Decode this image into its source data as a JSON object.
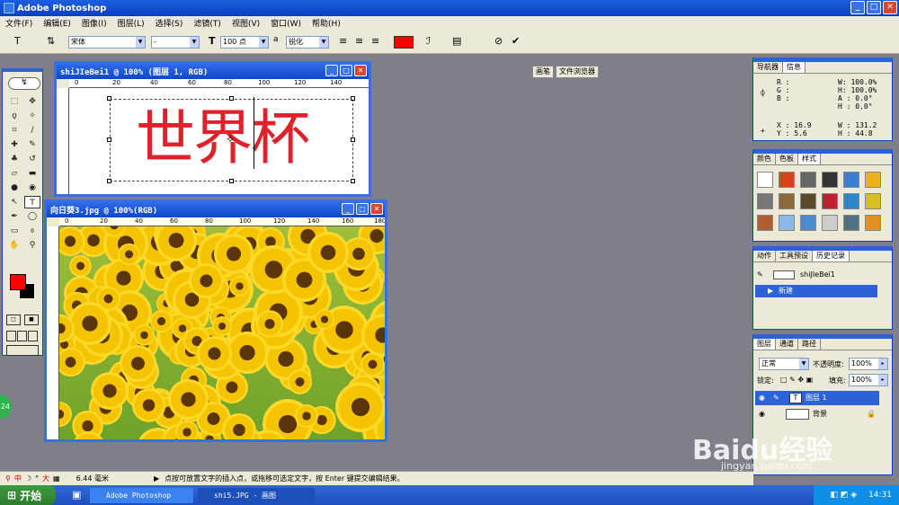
{
  "app": {
    "title": "Adobe Photoshop"
  },
  "menu": [
    "文件(F)",
    "编辑(E)",
    "图像(I)",
    "图层(L)",
    "选择(S)",
    "滤镜(T)",
    "视图(V)",
    "窗口(W)",
    "帮助(H)"
  ],
  "options": {
    "font_family": "宋体",
    "font_style": "-",
    "font_size": "100 点",
    "aa_prefix": "a",
    "aa_mode": "锐化",
    "text_color": "#ff0000",
    "tab_brush": "画笔",
    "tab_browser": "文件浏览器"
  },
  "doc1": {
    "title": "shiJIeBei1 @ 100% (图层 1, RGB)",
    "text": "世界杯",
    "ruler_ticks": [
      "0",
      "20",
      "40",
      "60",
      "80",
      "100",
      "120",
      "140"
    ]
  },
  "doc2": {
    "title": "向日葵3.jpg @ 100%(RGB)",
    "ruler_ticks": [
      "0",
      "20",
      "40",
      "60",
      "80",
      "100",
      "120",
      "140",
      "160",
      "180"
    ]
  },
  "navigator": {
    "tabs": [
      "导航器",
      "信息"
    ],
    "rgb": [
      "R :",
      "G :",
      "B :"
    ],
    "w1": "W: 100.0%",
    "h1": "H: 100.0%",
    "a": "A : 0.0°",
    "h2": "H : 0.0°",
    "x": "X : 16.9",
    "y": "Y : 5.6",
    "w2": "W : 131.2",
    "h3": "H : 44.8"
  },
  "styles": {
    "tabs": [
      "颜色",
      "色板",
      "样式"
    ]
  },
  "history": {
    "tabs": [
      "动作",
      "工具预设",
      "历史记录"
    ],
    "snapshot": "shiJIeBei1",
    "state": "新建"
  },
  "layers": {
    "tabs": [
      "图层",
      "通道",
      "路径"
    ],
    "blend": "正常",
    "opacity_label": "不透明度:",
    "opacity": "100%",
    "lock_label": "锁定:",
    "fill_label": "填充:",
    "fill": "100%",
    "layer1": "图层 1",
    "background": "背景"
  },
  "status": {
    "ime": "中",
    "ime_mode": "大",
    "measure": "6.44 毫米",
    "hint": "点按可放置文字的插入点，或拖移可选定文字，按 Enter 键提交编辑结果。"
  },
  "taskbar": {
    "start": "开始",
    "task1": "Adobe Photoshop",
    "task2": "shi5.JPG - 画图",
    "time": "14:31"
  },
  "watermark": {
    "main": "Baidu经验",
    "sub": "jingyan.baidu.com"
  },
  "bubble": "24"
}
